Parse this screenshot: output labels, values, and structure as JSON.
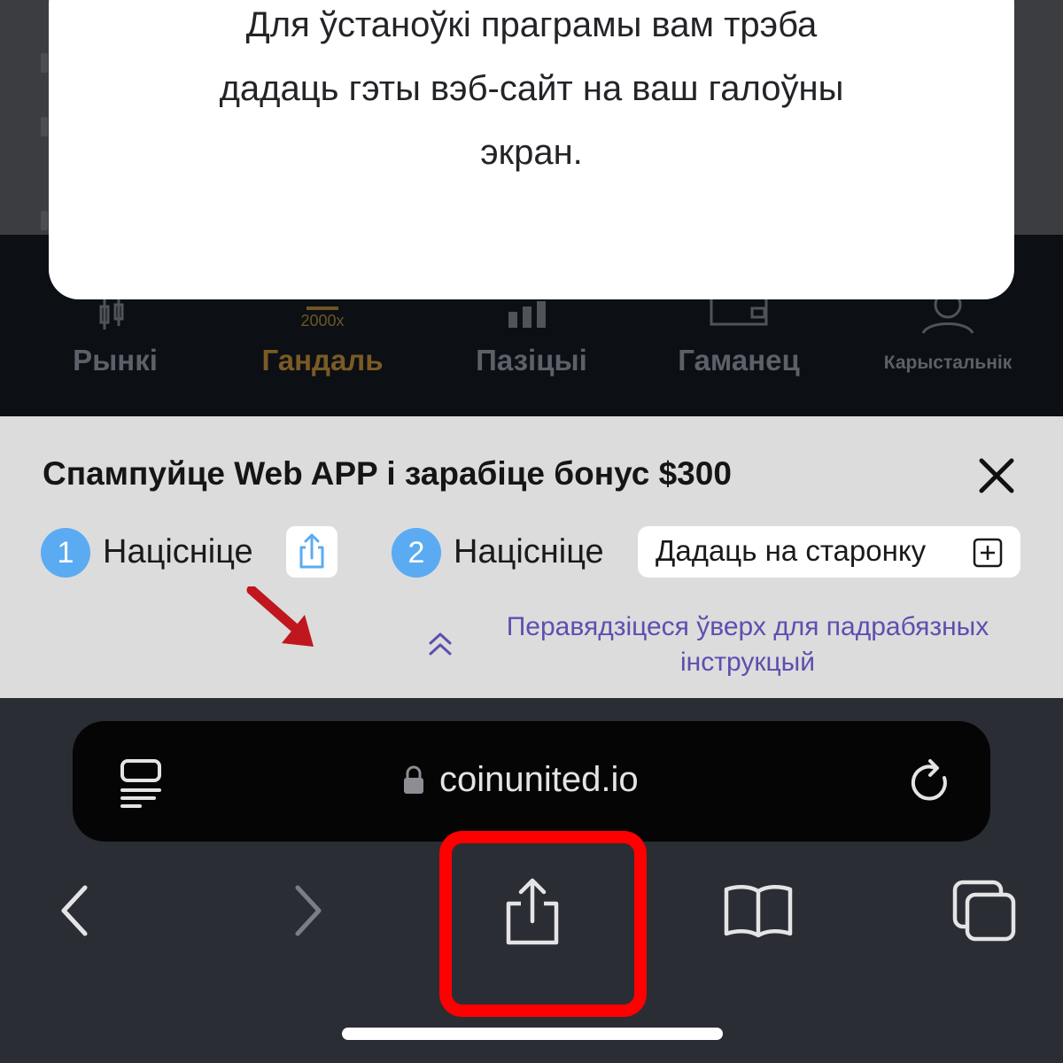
{
  "modal": {
    "message": "Для ўстаноўкі праграмы вам трэба дадаць гэты вэб-сайт на ваш галоўны экран."
  },
  "tabbar": {
    "tabs": [
      {
        "label": "Рынкі",
        "icon": "candlestick-icon"
      },
      {
        "label": "Гандаль",
        "icon": "trade-icon",
        "badge": "2000x",
        "active": true
      },
      {
        "label": "Пазіцыі",
        "icon": "bar-chart-icon"
      },
      {
        "label": "Гаманец",
        "icon": "wallet-icon"
      },
      {
        "label": "Карыстальнік",
        "icon": "user-icon"
      }
    ]
  },
  "banner": {
    "title": "Спампуйце Web APP і зарабіце бонус $300",
    "step1": {
      "number": "1",
      "label": "Націсніце",
      "icon": "share-icon"
    },
    "step2": {
      "number": "2",
      "label": "Націсніце",
      "button_label": "Дадаць на старонку",
      "icon": "add-square-icon"
    },
    "swipe_hint": "Перавядзіцеся ўверх для падрабязных інструкцый",
    "close_icon": "close-icon",
    "arrow_color": "#c0161d"
  },
  "browser": {
    "url": "coinunited.io",
    "highlight_color": "#ff0000",
    "toolbar": [
      "back-icon",
      "forward-icon",
      "share-icon",
      "bookmarks-icon",
      "tabs-icon"
    ]
  }
}
